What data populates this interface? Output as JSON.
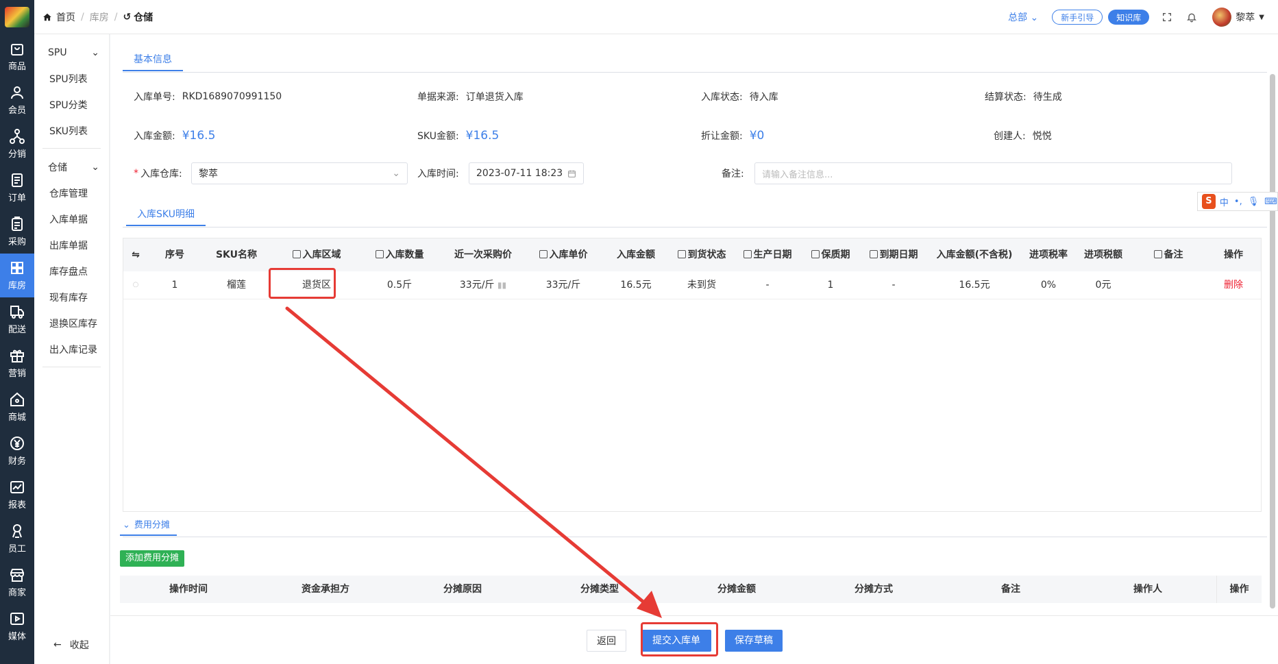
{
  "breadcrumb": {
    "home": "首页",
    "mid": "库房",
    "current": "仓储"
  },
  "topbar": {
    "branch": "总部",
    "guide": "新手引导",
    "kb": "知识库",
    "user": "黎萃"
  },
  "rail": [
    "商品",
    "会员",
    "分销",
    "订单",
    "采购",
    "库房",
    "配送",
    "营销",
    "商城",
    "财务",
    "报表",
    "员工",
    "商家",
    "媒体"
  ],
  "submenu": {
    "spu_group": "SPU",
    "spu_items": [
      "SPU列表",
      "SPU分类",
      "SKU列表"
    ],
    "wh_group": "仓储",
    "wh_items": [
      "仓库管理",
      "入库单据",
      "出库单据",
      "库存盘点",
      "现有库存",
      "退换区库存",
      "出入库记录"
    ],
    "collapse": "收起"
  },
  "basic": {
    "tab": "基本信息",
    "order_no_label": "入库单号:",
    "order_no": "RKD1689070991150",
    "source_label": "单据来源:",
    "source": "订单退货入库",
    "status_label": "入库状态:",
    "status": "待入库",
    "settle_label": "结算状态:",
    "settle": "待生成",
    "amount_label": "入库金额:",
    "amount": "¥16.5",
    "sku_amount_label": "SKU金额:",
    "sku_amount": "¥16.5",
    "discount_label": "折让金额:",
    "discount": "¥0",
    "creator_label": "创建人:",
    "creator": "悦悦",
    "warehouse_label": "入库仓库:",
    "warehouse": "黎萃",
    "time_label": "入库时间:",
    "time": "2023-07-11 18:23",
    "remark_label": "备注:",
    "remark_placeholder": "请输入备注信息..."
  },
  "sku": {
    "tab": "入库SKU明细",
    "headers": [
      "序号",
      "SKU名称",
      "入库区域",
      "入库数量",
      "近一次采购价",
      "入库单价",
      "入库金额",
      "到货状态",
      "生产日期",
      "保质期",
      "到期日期",
      "入库金额(不含税)",
      "进项税率",
      "进项税额",
      "备注",
      "操作"
    ],
    "row": {
      "index": "1",
      "name": "榴莲",
      "zone": "退货区",
      "qty": "0.5斤",
      "last_price": "33元/斤",
      "unit_price": "33元/斤",
      "amount": "16.5元",
      "arrival": "未到货",
      "prod_date": "-",
      "shelf": "1",
      "expire": "-",
      "amount_ex": "16.5元",
      "tax_rate": "0%",
      "tax": "0元",
      "remark": "",
      "op": "删除"
    }
  },
  "fee": {
    "tab": "费用分摊",
    "add": "添加费用分摊",
    "headers": [
      "操作时间",
      "资金承担方",
      "分摊原因",
      "分摊类型",
      "分摊金额",
      "分摊方式",
      "备注",
      "操作人",
      "操作"
    ]
  },
  "actions": {
    "back": "返回",
    "submit": "提交入库单",
    "draft": "保存草稿"
  },
  "ime": {
    "lang": "中"
  },
  "colors": {
    "primary": "#3d7fe8",
    "danger": "#e23333",
    "annotation": "#e63b35",
    "add": "#2fb155",
    "rail": "#1f2d3d"
  }
}
